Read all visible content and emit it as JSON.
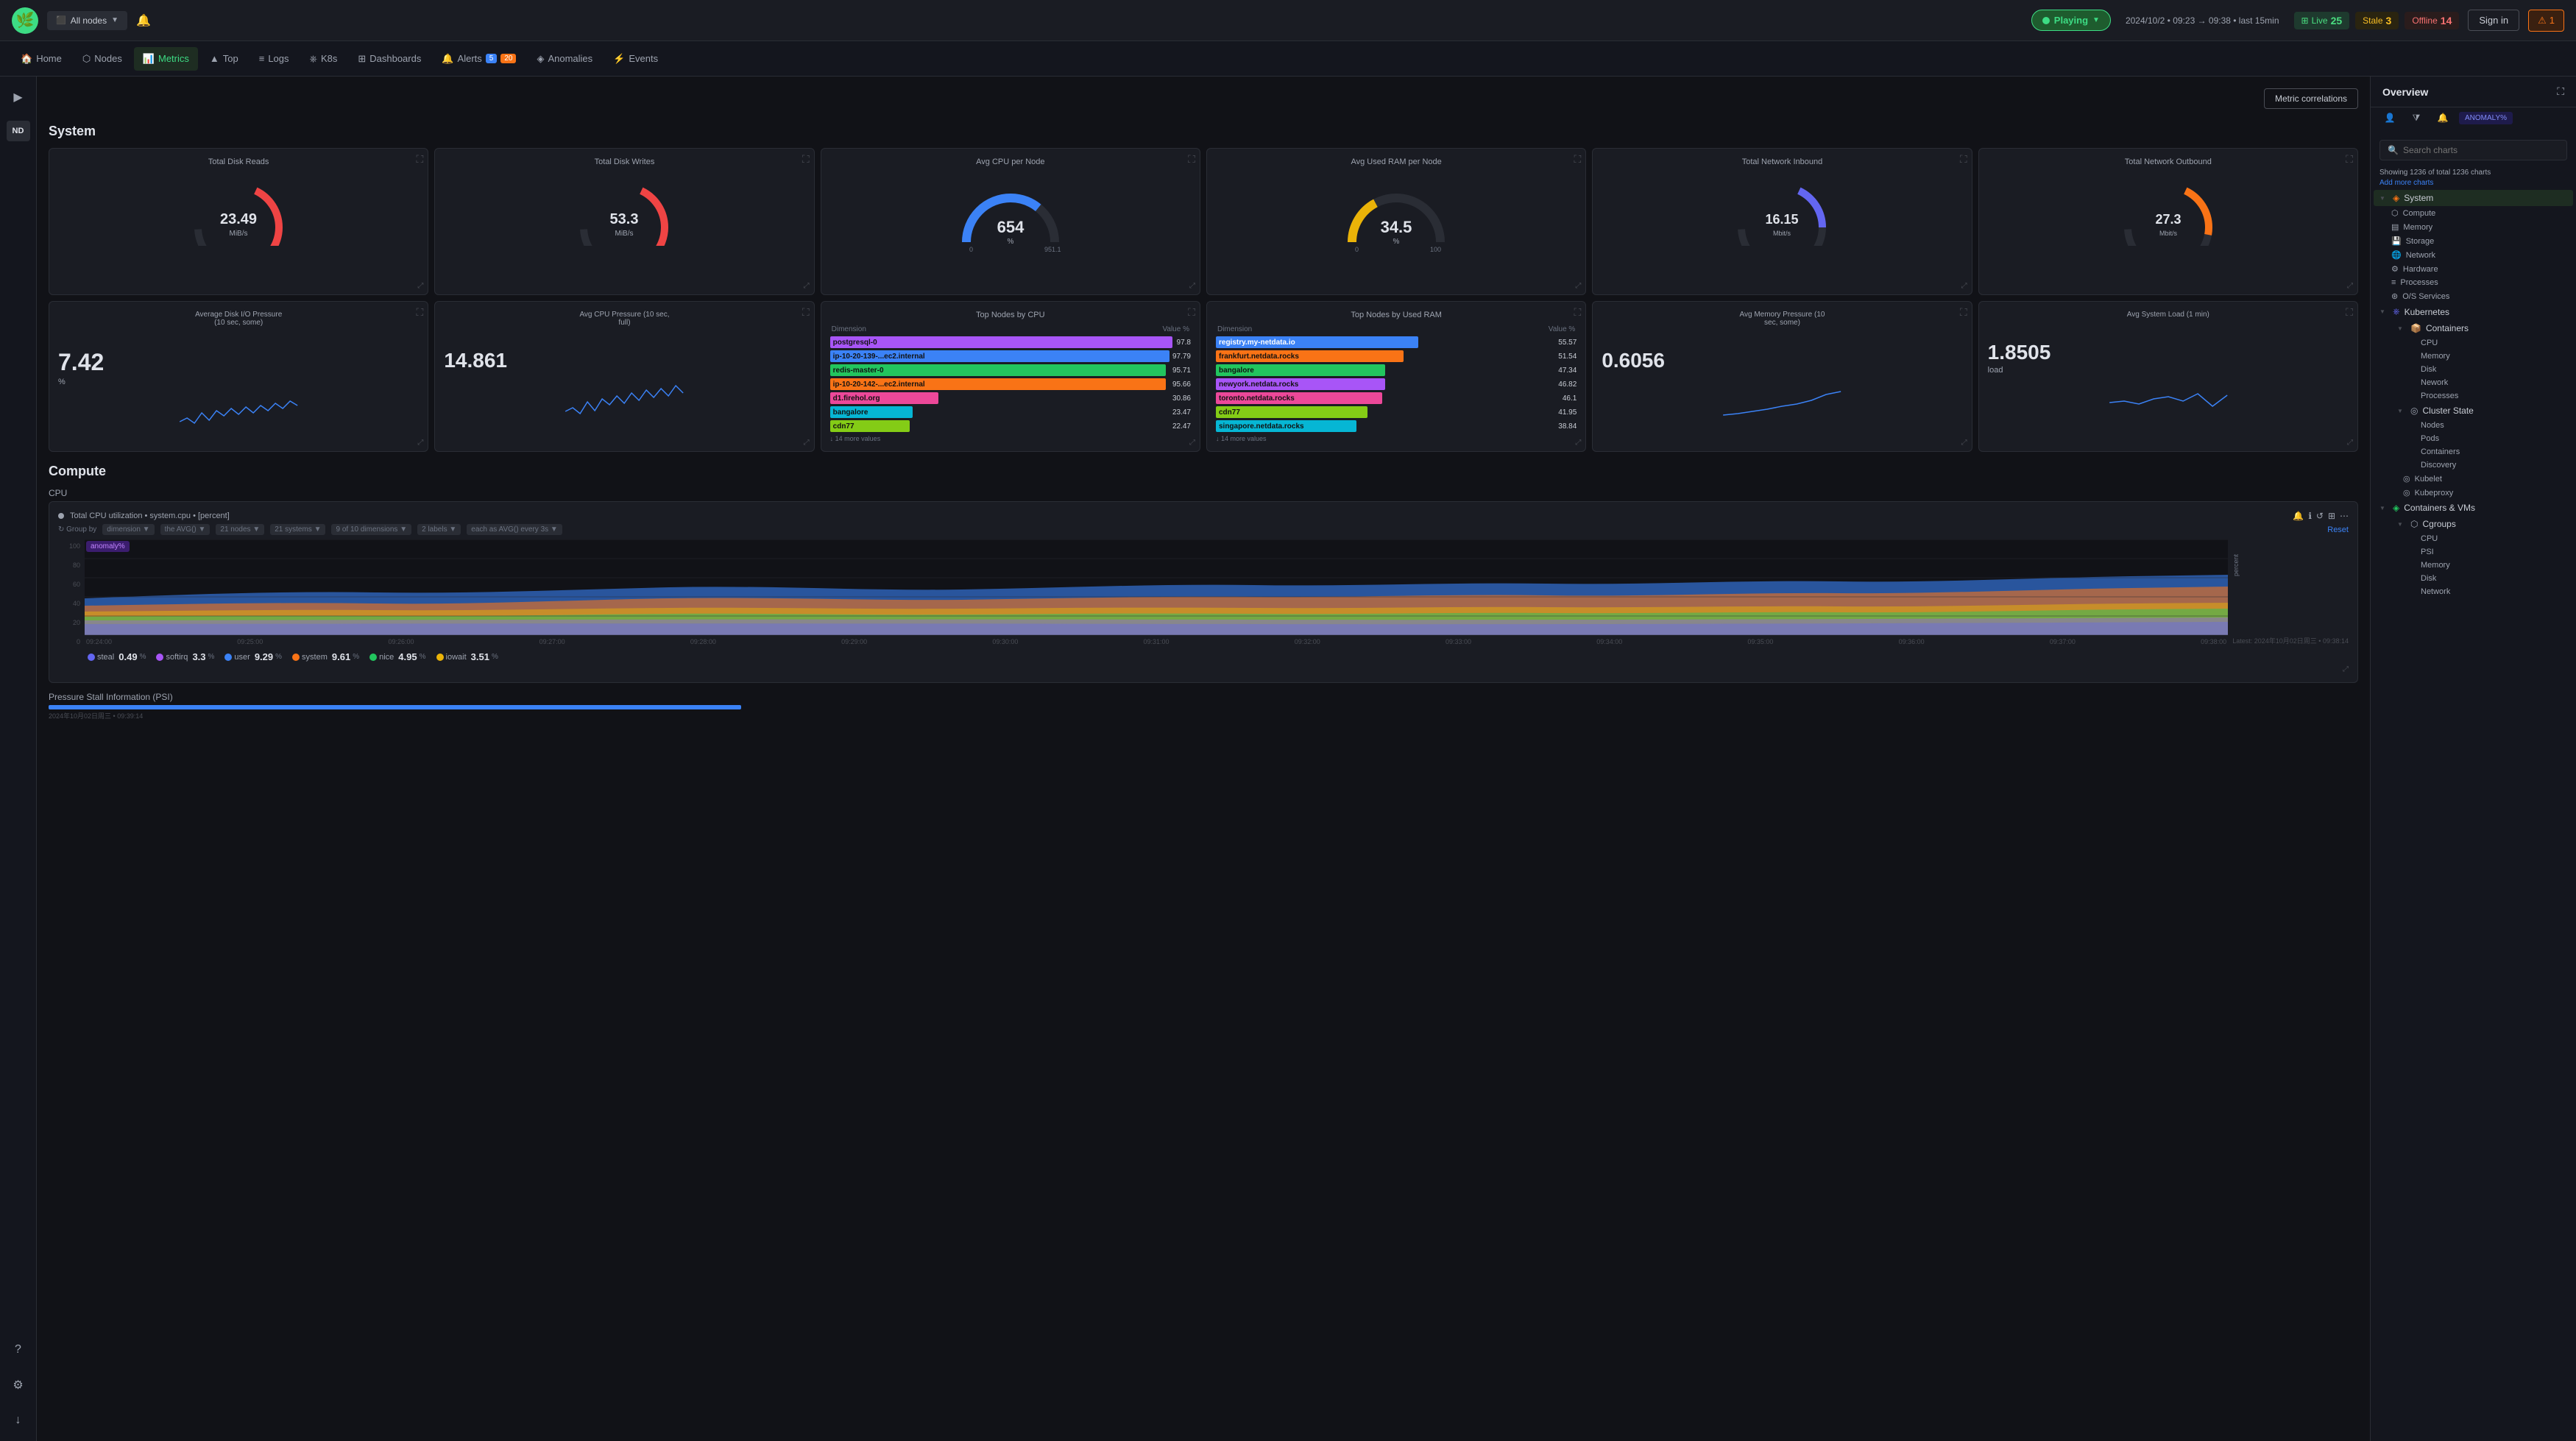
{
  "topbar": {
    "node_selector": "All nodes",
    "playing_label": "Playing",
    "time_range": "2024/10/2 • 09:23 → 09:38 • last 15min",
    "live_label": "Live",
    "live_count": "25",
    "stale_label": "Stale",
    "stale_count": "3",
    "offline_label": "Offline",
    "offline_count": "14",
    "signin_label": "Sign in",
    "alert_count": "1"
  },
  "subnav": {
    "items": [
      {
        "label": "Home",
        "icon": "home",
        "active": false
      },
      {
        "label": "Nodes",
        "icon": "nodes",
        "active": false
      },
      {
        "label": "Metrics",
        "icon": "metrics",
        "active": true
      },
      {
        "label": "Top",
        "icon": "top",
        "active": false
      },
      {
        "label": "Logs",
        "icon": "logs",
        "active": false
      },
      {
        "label": "K8s",
        "icon": "k8s",
        "active": false
      },
      {
        "label": "Dashboards",
        "icon": "dashboards",
        "active": false
      },
      {
        "label": "Alerts",
        "icon": "alerts",
        "badge_blue": "5",
        "badge_orange": "20",
        "active": false
      },
      {
        "label": "Anomalies",
        "icon": "anomalies",
        "active": false
      },
      {
        "label": "Events",
        "icon": "events",
        "active": false
      }
    ]
  },
  "metric_correlations_label": "Metric correlations",
  "system": {
    "title": "System",
    "gauges": [
      {
        "title": "Total Disk Reads",
        "value": "23.49",
        "unit": "MiB/s",
        "color": "#ef4444",
        "arc_color": "#ef4444",
        "bg_color": "#1a1c23"
      },
      {
        "title": "Total Disk Writes",
        "value": "53.3",
        "unit": "MiB/s",
        "color": "#ef4444",
        "arc_color": "#ef4444",
        "bg_color": "#1a1c23"
      },
      {
        "title": "Avg CPU per Node",
        "value": "654",
        "unit": "%",
        "color": "#3b82f6",
        "min": "0",
        "max": "951.1",
        "bg_color": "#1a1c23"
      },
      {
        "title": "Avg Used RAM per Node",
        "value": "34.5",
        "unit": "%",
        "color": "#eab308",
        "min": "0",
        "max": "100",
        "bg_color": "#1a1c23"
      },
      {
        "title": "Total Network Inbound",
        "value": "16.15",
        "unit": "Mbit/s",
        "color": "#6366f1",
        "bg_color": "#1a1c23"
      },
      {
        "title": "Total Network Outbound",
        "value": "27.3",
        "unit": "Mbit/s",
        "color": "#f97316",
        "bg_color": "#1a1c23"
      }
    ],
    "metrics_row2": [
      {
        "title": "Average Disk I/O Pressure\n(10 sec, some)",
        "value": "7.42",
        "unit": "%",
        "type": "sparkline"
      },
      {
        "title": "Avg CPU Pressure (10 sec,\nfull)",
        "value": "14.861",
        "unit": "",
        "type": "sparkline"
      },
      {
        "title": "Top Nodes by CPU",
        "type": "table",
        "headers": [
          "Dimension",
          "Value %"
        ],
        "rows": [
          {
            "label": "postgresql-0",
            "value": "97.8",
            "color": "#a855f7"
          },
          {
            "label": "ip-10-20-139-....ec2.internal",
            "value": "97.79",
            "color": "#3b82f6"
          },
          {
            "label": "redis-master-0",
            "value": "95.71",
            "color": "#22c55e"
          },
          {
            "label": "ip-10-20-142-....ec2.internal",
            "value": "95.66",
            "color": "#f97316"
          },
          {
            "label": "d1.firehol.org",
            "value": "30.86",
            "color": "#ec4899"
          },
          {
            "label": "bangalore",
            "value": "23.47",
            "color": "#06b6d4"
          },
          {
            "label": "cdn77",
            "value": "22.47",
            "color": "#84cc16"
          }
        ],
        "more": "↓ 14 more values"
      },
      {
        "title": "Top Nodes by Used RAM",
        "type": "table",
        "headers": [
          "Dimension",
          "Value %"
        ],
        "rows": [
          {
            "label": "registry.my-netdata.io",
            "value": "55.57",
            "color": "#3b82f6"
          },
          {
            "label": "frankfurt.netdata.rocks",
            "value": "51.54",
            "color": "#f97316"
          },
          {
            "label": "bangalore",
            "value": "47.34",
            "color": "#22c55e"
          },
          {
            "label": "newyork.netdata.rocks",
            "value": "46.82",
            "color": "#a855f7"
          },
          {
            "label": "toronto.netdata.rocks",
            "value": "46.1",
            "color": "#ec4899"
          },
          {
            "label": "cdn77",
            "value": "41.95",
            "color": "#84cc16"
          },
          {
            "label": "singapore.netdata.rocks",
            "value": "38.84",
            "color": "#06b6d4"
          }
        ],
        "more": "↓ 14 more values"
      },
      {
        "title": "Avg Memory Pressure (10\nsec, some)",
        "value": "0.6056",
        "unit": "",
        "type": "sparkline"
      },
      {
        "title": "Avg System Load (1 min)",
        "value": "1.8505",
        "unit": "load",
        "type": "sparkline_load"
      }
    ]
  },
  "compute": {
    "title": "Compute",
    "cpu_label": "CPU",
    "chart": {
      "legend_label": "Total CPU utilization",
      "series": "system.cpu",
      "unit": "[percent]",
      "group_by": "dimension",
      "avg_func": "the AVG()",
      "nodes": "21 nodes",
      "systems": "21 systems",
      "dimensions": "9 of 10 dimensions",
      "labels": "2 labels",
      "interval": "each as AVG() every 3s",
      "anomaly_pct_label": "anomaly%",
      "y_labels": [
        "100",
        "80",
        "60",
        "40",
        "20",
        "0"
      ],
      "x_labels": [
        "09:24:00",
        "09:25:00",
        "09:26:00",
        "09:27:00",
        "09:28:00",
        "09:29:00",
        "09:30:00",
        "09:31:00",
        "09:32:00",
        "09:33:00",
        "09:34:00",
        "09:35:00",
        "09:36:00",
        "09:37:00",
        "09:38:00"
      ],
      "reset_label": "Reset",
      "legend_items": [
        {
          "label": "steal",
          "value": "0.49",
          "unit": "%",
          "color": "#6366f1"
        },
        {
          "label": "softirq",
          "value": "3.3",
          "unit": "%",
          "color": "#a855f7"
        },
        {
          "label": "user",
          "value": "9.29",
          "unit": "%",
          "color": "#3b82f6"
        },
        {
          "label": "system",
          "value": "9.61",
          "unit": "%",
          "color": "#f97316"
        },
        {
          "label": "nice",
          "value": "4.95",
          "unit": "%",
          "color": "#22c55e"
        },
        {
          "label": "iowait",
          "value": "3.51",
          "unit": "%",
          "color": "#eab308"
        }
      ],
      "latest_label": "Latest: 2024年10月02日周三 • 09:38:14"
    },
    "psi_label": "Pressure Stall Information (PSI)",
    "psi_timestamp": "2024年10月02日周三 • 09:39:14"
  },
  "right_panel": {
    "title": "Overview",
    "search_placeholder": "Search charts",
    "showing": "Showing 1236 of total 1236 charts",
    "add_charts": "Add more charts",
    "anomaly_filter": "ANOMALY%",
    "tree": {
      "system": {
        "label": "System",
        "expanded": true,
        "children": [
          {
            "label": "Compute",
            "icon": "compute"
          },
          {
            "label": "Memory",
            "icon": "memory"
          },
          {
            "label": "Storage",
            "icon": "storage"
          },
          {
            "label": "Network",
            "icon": "network"
          },
          {
            "label": "Hardware",
            "icon": "hardware"
          },
          {
            "label": "Processes",
            "icon": "processes"
          },
          {
            "label": "O/S Services",
            "icon": "os"
          }
        ]
      },
      "kubernetes": {
        "label": "Kubernetes",
        "expanded": true,
        "children": [
          {
            "label": "Containers",
            "expanded": true,
            "children": [
              {
                "label": "CPU"
              },
              {
                "label": "Memory"
              },
              {
                "label": "Disk"
              },
              {
                "label": "Nework"
              },
              {
                "label": "Processes"
              }
            ]
          },
          {
            "label": "Cluster State",
            "expanded": true,
            "children": [
              {
                "label": "Nodes"
              },
              {
                "label": "Pods"
              },
              {
                "label": "Containers"
              },
              {
                "label": "Discovery"
              }
            ]
          },
          {
            "label": "Kubelet"
          },
          {
            "label": "Kubeproxy"
          }
        ]
      },
      "containers_vms": {
        "label": "Containers & VMs",
        "expanded": true,
        "children": [
          {
            "label": "Cgroups",
            "expanded": true,
            "children": [
              {
                "label": "CPU"
              },
              {
                "label": "PSI"
              },
              {
                "label": "Memory"
              },
              {
                "label": "Disk"
              },
              {
                "label": "Network"
              }
            ]
          }
        ]
      }
    },
    "panel_items": [
      {
        "label": "Network",
        "section": "System",
        "position": "700-752"
      },
      {
        "label": "CPU",
        "section": "Kubernetes",
        "position": "990-1039"
      },
      {
        "label": "Memory",
        "section": "Kubernetes",
        "position": "1038-1087"
      },
      {
        "label": "Discovery",
        "section": "Kubernetes Cluster State",
        "position": "1424-1474"
      },
      {
        "label": "CPU",
        "section": "Cgroups",
        "position": "1665-1714"
      },
      {
        "label": "Memory",
        "section": "Cgroups",
        "position": "1758-1810"
      }
    ]
  }
}
